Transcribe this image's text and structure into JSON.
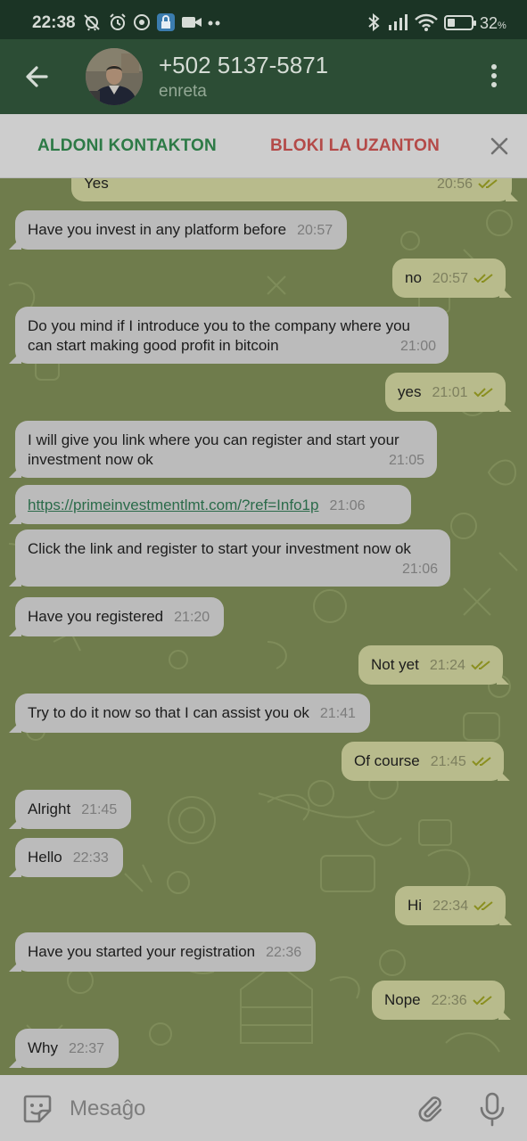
{
  "statusbar": {
    "time": "22:38",
    "battery_percent": "32",
    "battery_unit": "%",
    "battery_level": 0.32,
    "icons": [
      "alarm-off-icon",
      "alarm-icon",
      "nfc-icon",
      "vpn-lock-icon",
      "video-icon",
      "more-dots-icon",
      "bluetooth-icon",
      "signal-icon",
      "wifi-icon",
      "battery-icon"
    ]
  },
  "header": {
    "contact_name": "+502 5137-5871",
    "contact_status": "enreta"
  },
  "actions": {
    "add_contact": "ALDONI KONTAKTON",
    "block_user": "BLOKI LA UZANTON"
  },
  "messages": [
    {
      "dir": "out",
      "text": "Yes",
      "time": "20:56"
    },
    {
      "dir": "in",
      "text": "Have you invest in any platform before",
      "time": "20:57"
    },
    {
      "dir": "out",
      "text": "no",
      "time": "20:57"
    },
    {
      "dir": "in",
      "text": "Do you mind if I introduce you to the company where you can start making good profit in bitcoin",
      "time": "21:00"
    },
    {
      "dir": "out",
      "text": "yes",
      "time": "21:01"
    },
    {
      "dir": "in",
      "text": "I will give you link where you can register and start your investment now ok",
      "time": "21:05"
    },
    {
      "dir": "in",
      "text": "https://primeinvestmentlmt.com/?ref=Info1p",
      "time": "21:06"
    },
    {
      "dir": "in",
      "text": "Click the link and register to start your investment now ok",
      "time": "21:06"
    },
    {
      "dir": "in",
      "text": "Have you registered",
      "time": "21:20"
    },
    {
      "dir": "out",
      "text": "Not yet",
      "time": "21:24"
    },
    {
      "dir": "in",
      "text": "Try to do it now so that I can assist you ok",
      "time": "21:41"
    },
    {
      "dir": "out",
      "text": "Of course",
      "time": "21:45"
    },
    {
      "dir": "in",
      "text": "Alright",
      "time": "21:45"
    },
    {
      "dir": "in",
      "text": "Hello",
      "time": "22:33"
    },
    {
      "dir": "out",
      "text": "Hi",
      "time": "22:34"
    },
    {
      "dir": "in",
      "text": "Have you started your registration",
      "time": "22:36"
    },
    {
      "dir": "out",
      "text": "Nope",
      "time": "22:36"
    },
    {
      "dir": "in",
      "text": "Why",
      "time": "22:37"
    }
  ],
  "input": {
    "placeholder": "Mesaĝo"
  },
  "colors": {
    "header": "#2c4d35",
    "add_action": "#2d7a46",
    "block_action": "#b44a48",
    "incoming_bubble": "#bbbbbb",
    "outgoing_bubble": "#b8bb8c",
    "read_ticks": "#8a8f20"
  }
}
